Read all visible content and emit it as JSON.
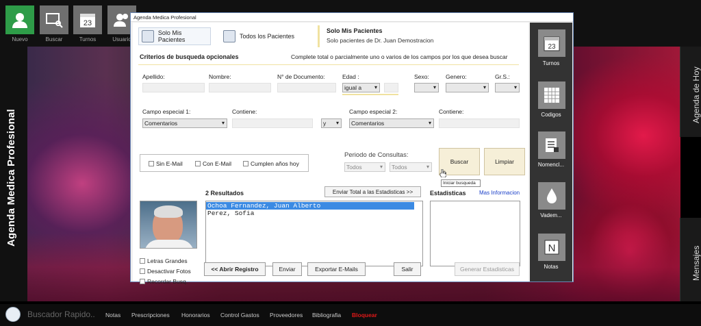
{
  "app": {
    "side_title": "Agenda Medica Profesional"
  },
  "toolbar": {
    "items": [
      {
        "label": "Nuevo",
        "icon": "user-icon"
      },
      {
        "label": "Buscar",
        "icon": "search-icon"
      },
      {
        "label": "Turnos",
        "icon": "calendar-icon"
      },
      {
        "label": "Usuario",
        "icon": "users-icon"
      }
    ]
  },
  "right_tabs": {
    "agenda": "Agenda de Hoy",
    "messages": "Mensajes"
  },
  "bottom": {
    "quick_search_placeholder": "Buscador Rapido..",
    "links": [
      "Notas",
      "Prescripciones",
      "Honorarios",
      "Control Gastos",
      "Proveedores",
      "Bibliografia",
      "Bloquear"
    ]
  },
  "window": {
    "title": "Agenda Medica Profesional",
    "tab_mine": "Solo Mis Pacientes",
    "tab_all": "Todos los Pacientes",
    "info_title": "Solo Mis Pacientes",
    "info_sub": "Solo pacientes de Dr. Juan Demostracion",
    "criteria_title": "Criterios de busqueda opcionales",
    "criteria_hint": "Complete total o parcialmente uno o varios de los campos por los que desea buscar",
    "fields": {
      "apellido": "Apellido:",
      "nombre": "Nombre:",
      "documento": "N° de Documento:",
      "edad": "Edad :",
      "edad_op": "igual a",
      "sexo": "Sexo:",
      "genero": "Genero:",
      "grs": "Gr.S.:",
      "campo1": "Campo especial 1:",
      "campo1_val": "Comentarios",
      "contiene1": "Contiene:",
      "conj": "y",
      "campo2": "Campo especial 2:",
      "campo2_val": "Comentarios",
      "contiene2": "Contiene:"
    },
    "checks": {
      "sin_email": "Sin E-Mail",
      "con_email": "Con E-Mail",
      "cumple": "Cumplen años hoy"
    },
    "periodo_label": "Periodo de Consultas:",
    "periodo_from": "Todos",
    "periodo_to": "Todos",
    "buscar": "Buscar",
    "limpiar": "Limpiar",
    "tooltip": "Iniciar busqueda",
    "results_count": "2 Resultados",
    "send_stats": "Enviar Total a las Estadisticas >>",
    "results": [
      "Ochoa Fernandez, Juan Alberto",
      "Perez, Sofia"
    ],
    "stats_label": "Estadisticas",
    "more_info": "Mas Informacion",
    "options": {
      "big_letters": "Letras Grandes",
      "no_photos": "Desactivar Fotos",
      "remember": "Recordar Busq."
    },
    "actions": {
      "open": "<< Abrir Registro",
      "send": "Enviar",
      "export": "Exportar E-Mails",
      "exit": "Salir",
      "gen_stats": "Generar Estadisticas"
    }
  },
  "sidebar": {
    "items": [
      {
        "label": "Turnos",
        "icon": "calendar-icon"
      },
      {
        "label": "Codigos",
        "icon": "grid-icon"
      },
      {
        "label": "Nomencl...",
        "icon": "list-icon"
      },
      {
        "label": "Vadem...",
        "icon": "drop-icon"
      },
      {
        "label": "Notas",
        "icon": "notes-icon"
      }
    ]
  }
}
